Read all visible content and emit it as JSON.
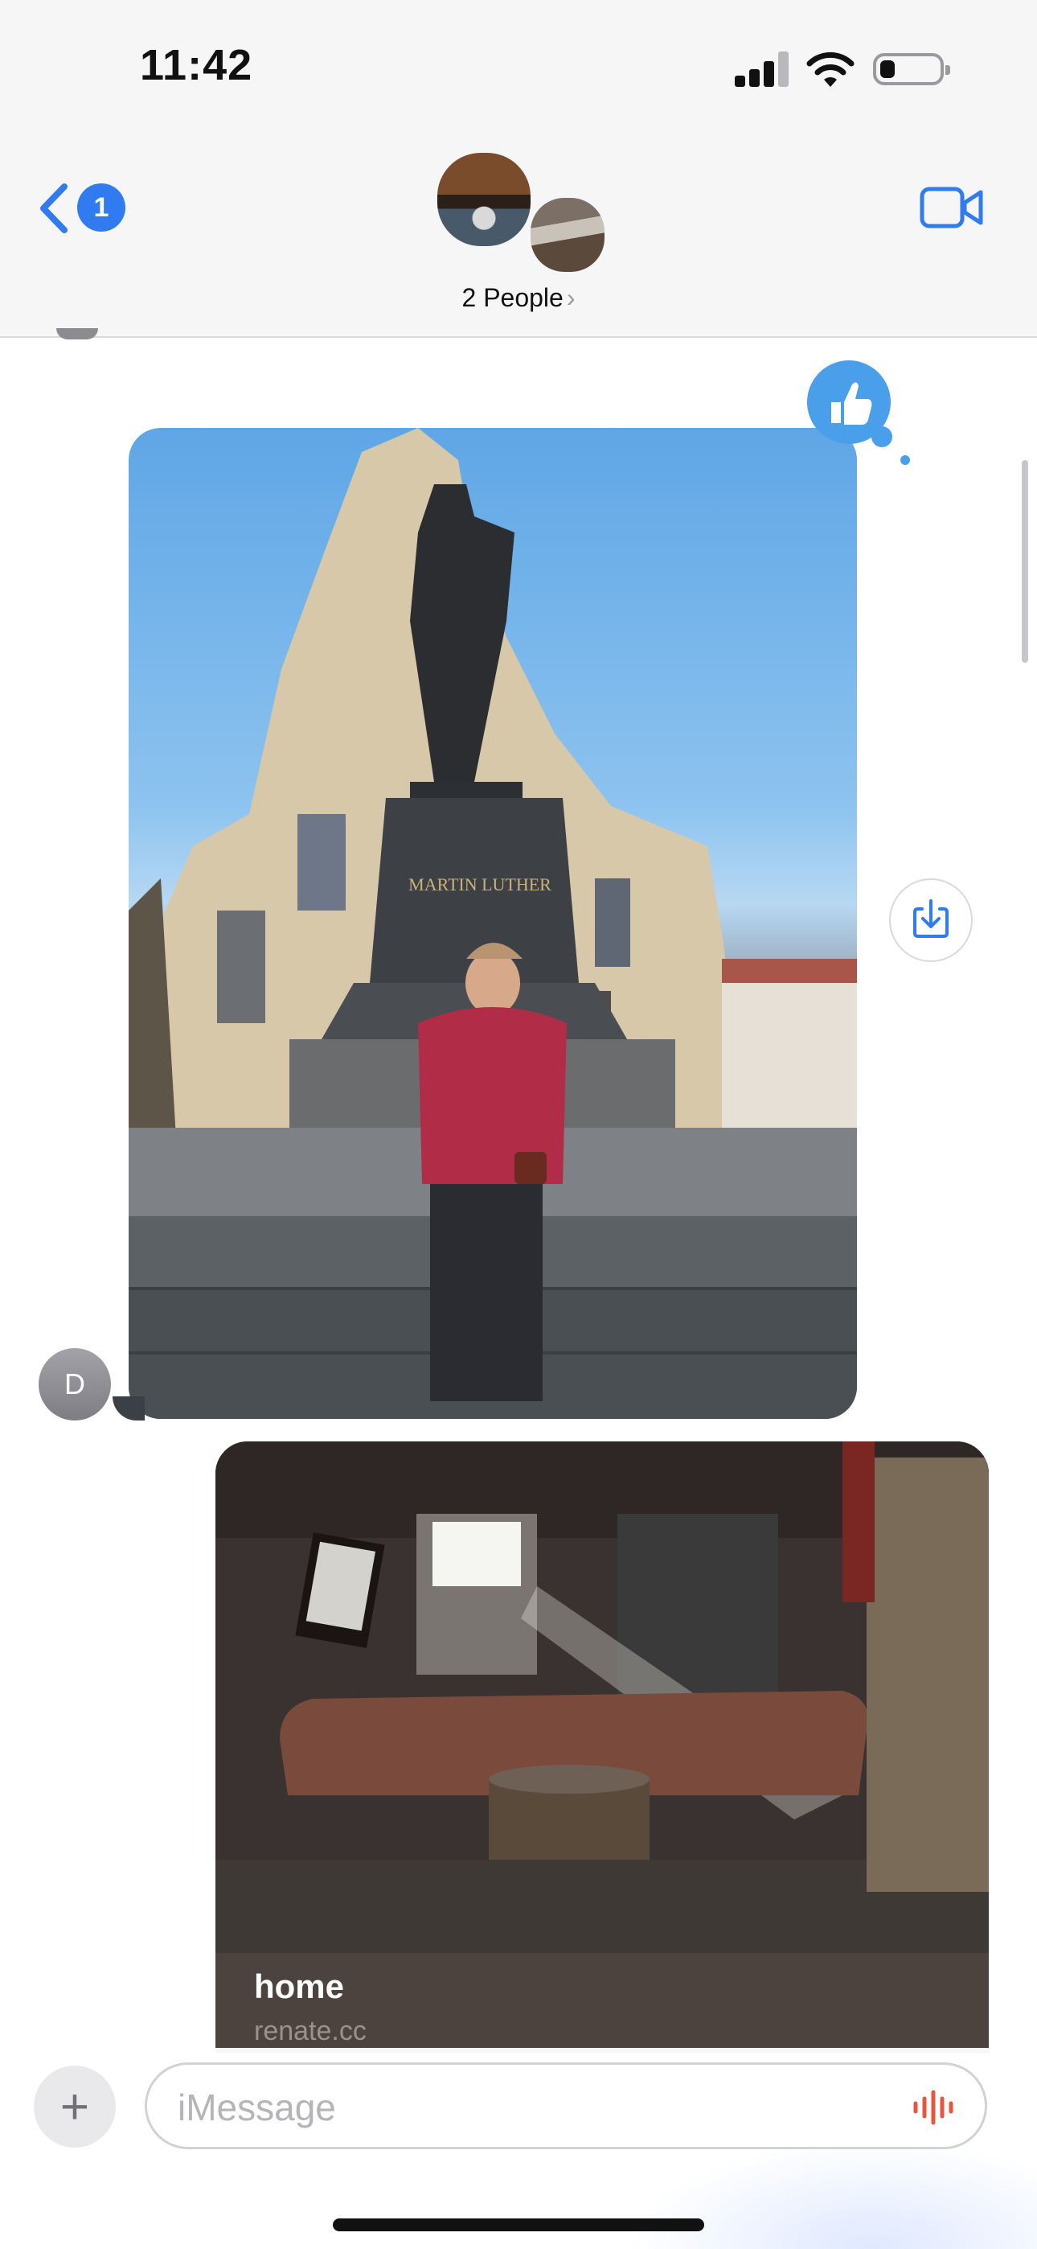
{
  "status_bar": {
    "time": "11:42"
  },
  "header": {
    "back_badge": "1",
    "people_label": "2 People",
    "people_chevron": "›",
    "icons": [
      "chevron-left-icon",
      "video-camera-icon"
    ]
  },
  "thread": {
    "photo_message": {
      "statue_inscription": "MARTIN LUTHER",
      "tapback": "thumbs-up-icon",
      "sender_initial": "D"
    },
    "link_preview": {
      "title": "home",
      "domain": "renate.cc"
    }
  },
  "composer": {
    "placeholder": "iMessage",
    "plus_label": "+"
  },
  "colors": {
    "accent": "#2f7bef",
    "tapback": "#4a9fea",
    "audio": "#e8553f"
  }
}
